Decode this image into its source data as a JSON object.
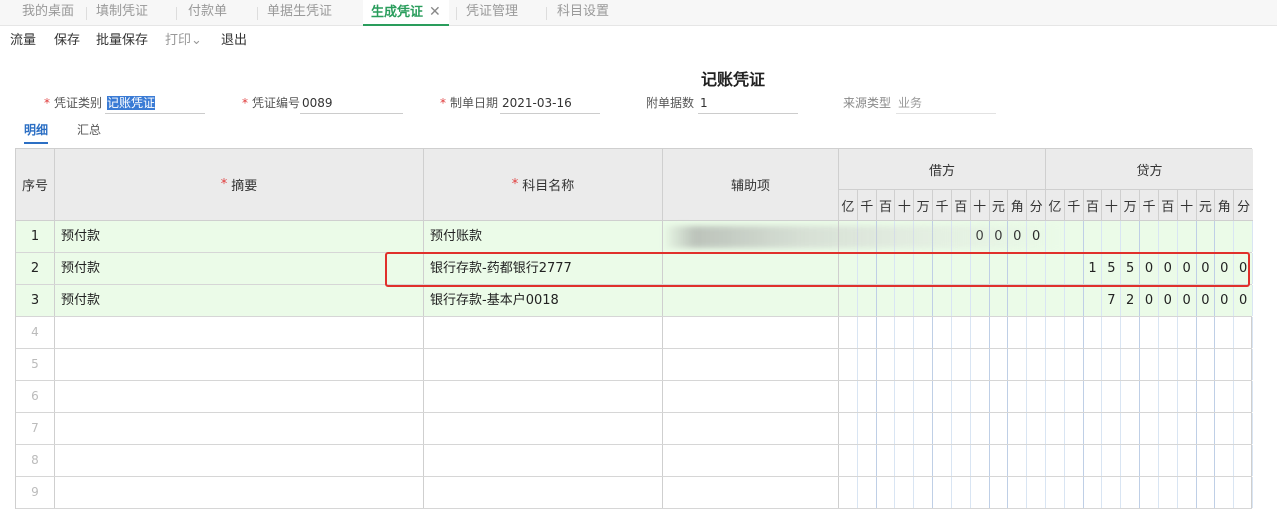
{
  "tabs": [
    {
      "label": "我的桌面",
      "active": false
    },
    {
      "label": "填制凭证",
      "active": false
    },
    {
      "label": "付款单",
      "active": false
    },
    {
      "label": "单据生凭证",
      "active": false
    },
    {
      "label": "生成凭证",
      "active": true
    },
    {
      "label": "凭证管理",
      "active": false
    },
    {
      "label": "科目设置",
      "active": false
    }
  ],
  "tab_close_glyph": "✕",
  "toolbar": {
    "flow": "流量",
    "save": "保存",
    "batch_save": "批量保存",
    "print": "打印",
    "print_caret": "⌄",
    "exit": "退出"
  },
  "title": "记账凭证",
  "header": {
    "voucher_type": {
      "label": "凭证类别",
      "value": "记账凭证"
    },
    "voucher_no": {
      "label": "凭证编号",
      "value": "0089"
    },
    "date": {
      "label": "制单日期",
      "value": "2021-03-16"
    },
    "attachments": {
      "label": "附单据数",
      "value": "1"
    },
    "source": {
      "label": "来源类型",
      "value": "业务"
    }
  },
  "subtabs": {
    "detail": "明细",
    "summary": "汇总"
  },
  "grid": {
    "columns": {
      "index": "序号",
      "summary": "摘要",
      "account": "科目名称",
      "aux": "辅助项",
      "debit": "借方",
      "credit": "贷方"
    },
    "digit_units": [
      "亿",
      "千",
      "百",
      "十",
      "万",
      "千",
      "百",
      "十",
      "元",
      "角",
      "分"
    ],
    "rows": [
      {
        "index": "1",
        "summary": "预付款",
        "account": "预付账款",
        "debit": [
          "",
          "",
          "",
          "",
          "",
          "",
          "",
          "0",
          "0",
          "0",
          "0"
        ],
        "credit": [
          "",
          "",
          "",
          "",
          "",
          "",
          "",
          "",
          "",
          "",
          ""
        ]
      },
      {
        "index": "2",
        "summary": "预付款",
        "account": "银行存款-药都银行2777",
        "debit": [
          "",
          "",
          "",
          "",
          "",
          "",
          "",
          "",
          "",
          "",
          ""
        ],
        "credit": [
          "",
          "",
          "1",
          "5",
          "5",
          "0",
          "0",
          "0",
          "0",
          "0",
          "0"
        ]
      },
      {
        "index": "3",
        "summary": "预付款",
        "account": "银行存款-基本户0018",
        "debit": [
          "",
          "",
          "",
          "",
          "",
          "",
          "",
          "",
          "",
          "",
          ""
        ],
        "credit": [
          "",
          "",
          "",
          "7",
          "2",
          "0",
          "0",
          "0",
          "0",
          "0",
          "0"
        ]
      },
      {
        "index": "4",
        "summary": "",
        "account": "",
        "debit": [],
        "credit": []
      },
      {
        "index": "5",
        "summary": "",
        "account": "",
        "debit": [],
        "credit": []
      },
      {
        "index": "6",
        "summary": "",
        "account": "",
        "debit": [],
        "credit": []
      },
      {
        "index": "7",
        "summary": "",
        "account": "",
        "debit": [],
        "credit": []
      },
      {
        "index": "8",
        "summary": "",
        "account": "",
        "debit": [],
        "credit": []
      },
      {
        "index": "9",
        "summary": "",
        "account": "",
        "debit": [],
        "credit": []
      }
    ]
  },
  "colors": {
    "accent_green": "#2a9d5c",
    "accent_blue": "#2c6fc4",
    "required_red": "#e03b3b",
    "highlight_red": "#e0302b",
    "filled_row_bg": "#ebfbe8"
  }
}
